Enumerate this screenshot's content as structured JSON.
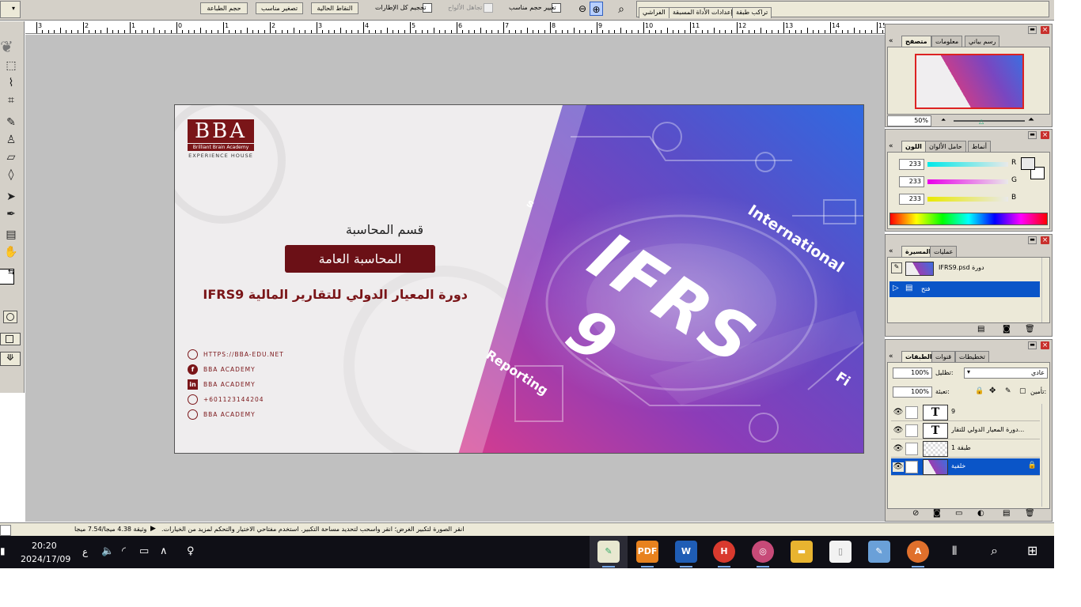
{
  "optionsbar": {
    "buttons": {
      "print_size": "حجم الطباعة",
      "fit_screen": "تصغير مناسب",
      "actual_pixels": "النقاط الحالية"
    },
    "checkboxes": {
      "zoom_all_windows": "تحجيم كل الإطارات",
      "ignore_palettes": "تجاهل الألواح",
      "resize_windows": "تغيير حجم مناسب"
    },
    "well_tabs": [
      "الفراشي",
      "إعدادات الأداة المسبقة",
      "تراكب طبقة"
    ]
  },
  "ruler": {
    "labels": [
      "3",
      "2",
      "1",
      "0",
      "1",
      "2",
      "3",
      "4",
      "5",
      "6",
      "7",
      "8",
      "9",
      "10",
      "11",
      "12",
      "13",
      "14",
      "15"
    ]
  },
  "navigator": {
    "tabs": [
      "متصفح",
      "معلومات",
      "رسم بياني"
    ],
    "zoom": "50%"
  },
  "color": {
    "tabs": [
      "اللون",
      "حامل الألوان",
      "أنماط"
    ],
    "r": "233",
    "g": "233",
    "b": "233",
    "r_label": "R",
    "g_label": "G",
    "b_label": "B"
  },
  "history": {
    "tabs": [
      "المسيرة",
      "عمليات"
    ],
    "snapshot_label": "IFRS9.psd دورة",
    "items": [
      "فتح"
    ]
  },
  "layers": {
    "tabs": [
      "الطبقات",
      "قنوات",
      "تخطيطات"
    ],
    "blend_mode": "عادي",
    "opacity_label": "تظليل:",
    "opacity": "100%",
    "lock_label": "تأمين:",
    "fill_label": "تعبئة:",
    "fill": "100%",
    "rows": [
      {
        "name": "9",
        "type": "T",
        "selected": false
      },
      {
        "name": "دورة المعيار الدولي للتقار...",
        "type": "T",
        "selected": false
      },
      {
        "name": "طبقة 1",
        "type": "",
        "selected": false
      },
      {
        "name": "خلفية",
        "type": "",
        "selected": true
      }
    ]
  },
  "canvas": {
    "logo_big": "BBA",
    "logo_sub": "Brilliant Brain Academy",
    "logo_tag": "Experience House",
    "dept": "قسم المحاسبة",
    "button": "المحاسبة العامة",
    "course": "دورة المعيار الدولي للتقارير المالية IFRS9",
    "contacts": [
      {
        "icon": "globe-icon",
        "text": "HTTPS://BBA-EDU.NET"
      },
      {
        "icon": "facebook-icon",
        "text": "BBA ACADEMY"
      },
      {
        "icon": "linkedin-icon",
        "text": "BBA ACADEMY"
      },
      {
        "icon": "whatsapp-icon",
        "text": "+601123144204"
      },
      {
        "icon": "youtube-icon",
        "text": "BBA ACADEMY"
      }
    ],
    "big_text": "IFRS",
    "big_num": "9",
    "word_international": "International",
    "word_reporting": "Reporting",
    "word_fi": "Fi",
    "word_s": "s"
  },
  "statusbar": {
    "doc_size": "وثيقة 4.38 ميجا/7.54 ميجا",
    "hint": "انقر الصورة لتكبير الغرض؛ انقر واسحب لتحديد مساحة التكبير. استخدم مفتاحي الاختيار والتحكم لمزيد من الخيارات."
  },
  "taskbar": {
    "time": "20:20",
    "date": "2024/17/09",
    "lang": "ع"
  },
  "colors": {
    "accent_red": "#7a1518",
    "selection_blue": "#0a55c8"
  }
}
